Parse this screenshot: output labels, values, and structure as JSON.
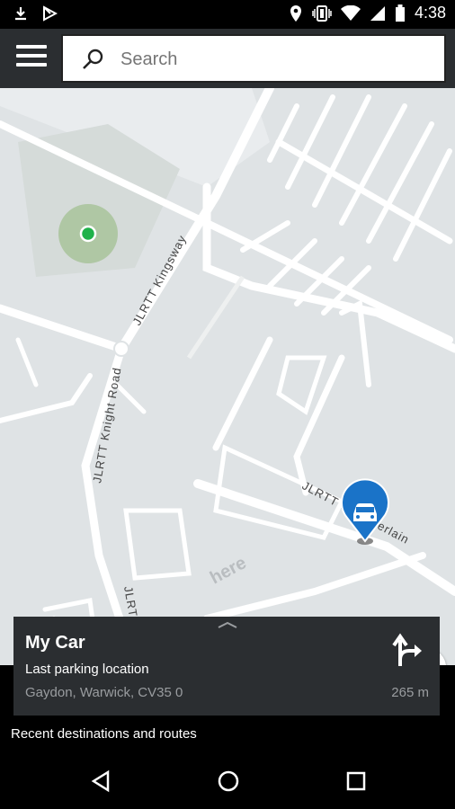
{
  "status_bar": {
    "time": "4:38",
    "icons": [
      "download-icon",
      "play-store-icon",
      "location-icon",
      "vibrate-icon",
      "wifi-icon",
      "signal-icon",
      "battery-icon"
    ]
  },
  "app_bar": {
    "menu_icon": "hamburger-menu-icon",
    "search": {
      "placeholder": "Search",
      "value": ""
    }
  },
  "map": {
    "labels": {
      "kingsway": "JLRTT Kingsway",
      "knight_road": "JLRTT Knight Road",
      "chamberlain": "JLRTT Chamberlain",
      "bottom_road": "JLRTT",
      "watermark": "here"
    },
    "colors": {
      "land": "#dfe3e5",
      "road": "#ffffff",
      "location_dot": "#1fb24a",
      "car_pin": "#1a73c8"
    }
  },
  "car_card": {
    "title": "My Car",
    "subtitle": "Last parking location",
    "address": "Gaydon, Warwick, CV35 0",
    "distance": "265 m"
  },
  "recent": {
    "label": "Recent destinations and routes"
  },
  "nav_bar": {
    "icons": [
      "back-icon",
      "home-icon",
      "recents-icon"
    ]
  }
}
